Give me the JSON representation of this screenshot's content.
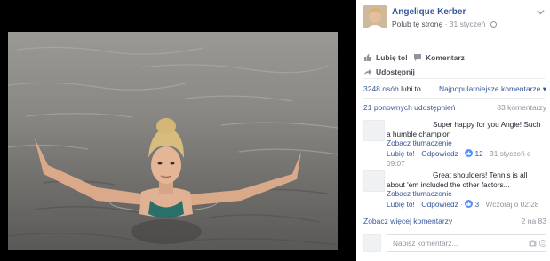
{
  "page": {
    "name": "Angelique Kerber",
    "like_page_label": "Polub tę stronę",
    "separator": "·",
    "date": "31 styczeń"
  },
  "actions": {
    "like_label": "Lubię to!",
    "comment_label": "Komentarz",
    "share_label": "Udostępnij"
  },
  "stats": {
    "likes_count": "3248 osób",
    "likes_suffix": "lubi to.",
    "sort_label": "Najpopularniejsze komentarze ▾",
    "shares": "21 ponownych udostępnień",
    "comments_total": "83 komentarzy"
  },
  "comments": [
    {
      "text": "Super happy for you Angie! Such a humble champion",
      "translate": "Zobacz tłumaczenie",
      "like": "Lubię to!",
      "reply": "Odpowiedz",
      "sep": "·",
      "reactions": "12",
      "time": "31 styczeń o 09:07"
    },
    {
      "text": "Great shoulders! Tennis is all about 'em included the other factors...",
      "translate": "Zobacz tłumaczenie",
      "like": "Lubię to!",
      "reply": "Odpowiedz",
      "sep": "·",
      "reactions": "3",
      "time": "Wczoraj o 02:28"
    }
  ],
  "more_comments": "Zobacz więcej komentarzy",
  "page_count": "2 na 83",
  "composer": {
    "placeholder": "Napisz komentarz..."
  },
  "icons": [
    "chevron-down-icon",
    "globe-icon",
    "like-icon",
    "comment-icon",
    "share-icon",
    "camera-icon",
    "emoji-icon",
    "thumb-up-icon"
  ],
  "colors": {
    "link": "#365899",
    "muted": "#90949c",
    "viewer_bg": "#000000",
    "like_blue": "#5890ff"
  }
}
